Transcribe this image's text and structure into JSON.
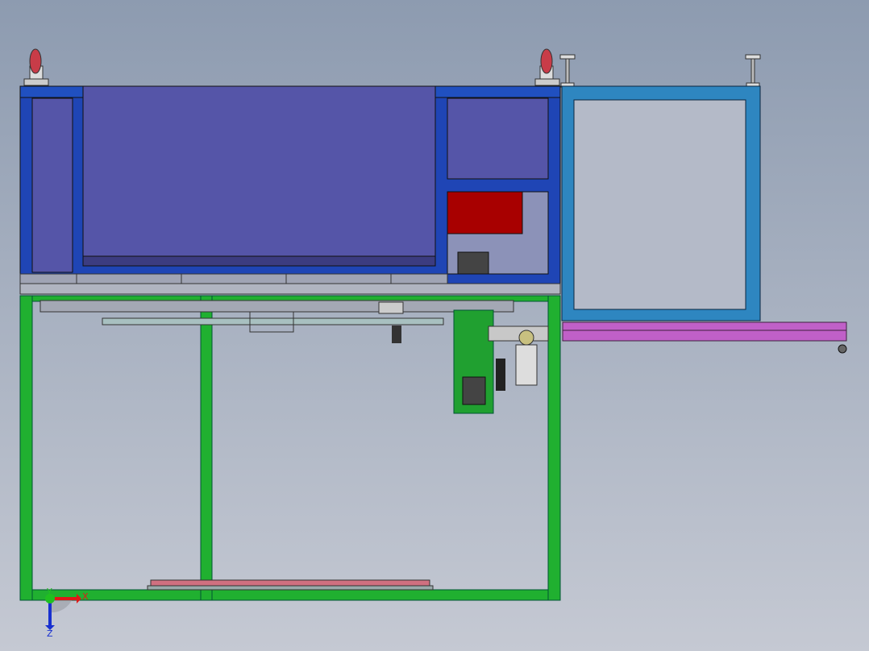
{
  "viewport": {
    "background_top": "#8d9bb0",
    "background_bottom": "#c5c9d3"
  },
  "colors": {
    "cabinet_frame": "#1f45b5",
    "cabinet_panel": "#5555a8",
    "warning_block": "#a80000",
    "green_frame": "#20b030",
    "side_frame": "#2e86c0",
    "side_rail": "#c060c8",
    "caster_wheel": "#c83c48"
  },
  "triad": {
    "x_label": "X",
    "y_label": "Y",
    "z_label": "Z",
    "x_color": "#e01818",
    "y_color": "#20c020",
    "z_color": "#1830d0"
  }
}
